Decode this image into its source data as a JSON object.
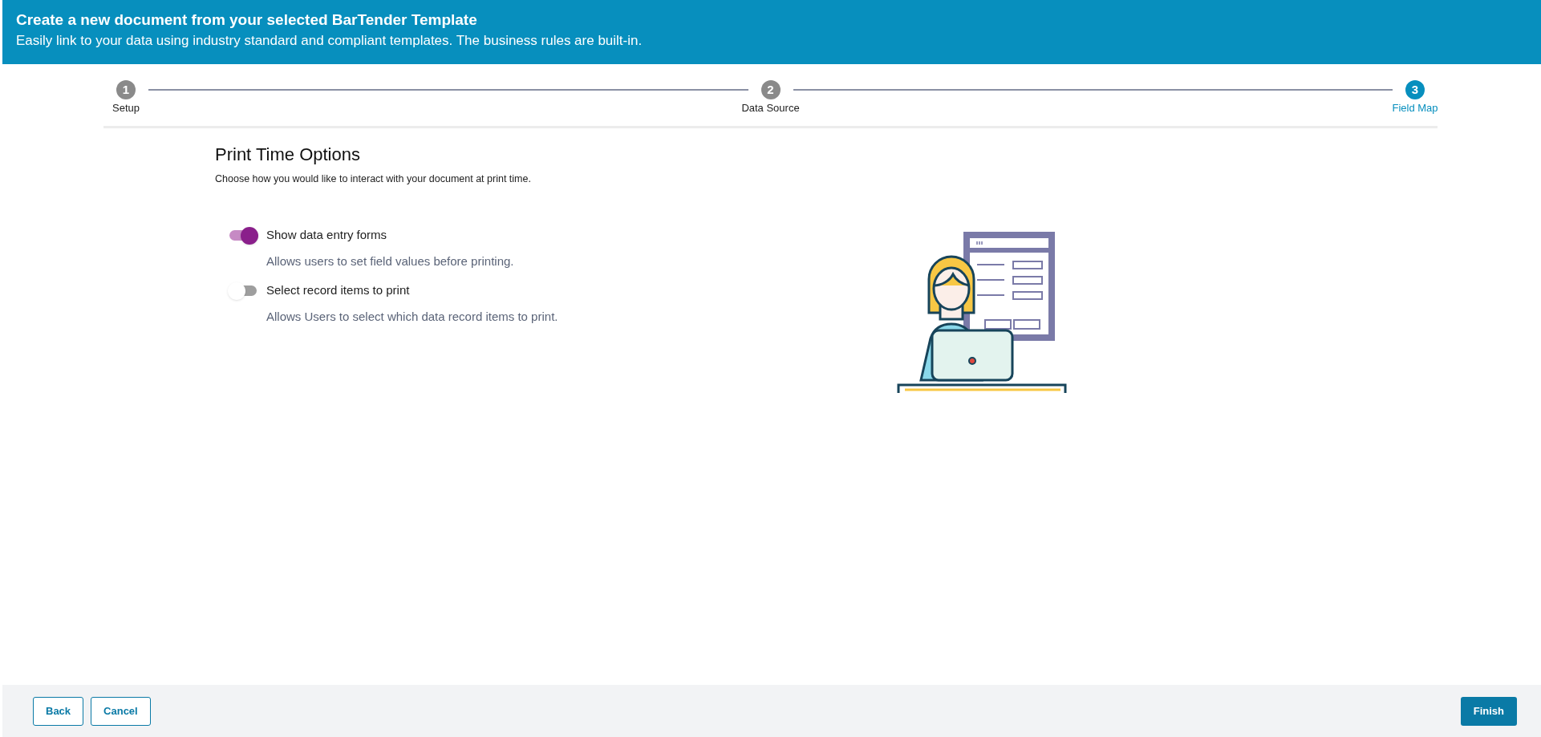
{
  "header": {
    "title": "Create a new document from your selected BarTender Template",
    "subtitle": "Easily link to your data using industry standard and compliant templates. The business rules are built-in."
  },
  "steps": [
    {
      "number": "1",
      "label": "Setup",
      "selected": false
    },
    {
      "number": "2",
      "label": "Data Source",
      "selected": false
    },
    {
      "number": "3",
      "label": "Field Map",
      "selected": true
    }
  ],
  "section": {
    "title": "Print Time Options",
    "description": "Choose how you would like to interact with your document at print time."
  },
  "options": [
    {
      "label": "Show data entry forms",
      "hint": "Allows users to set field values before printing.",
      "on": true
    },
    {
      "label": "Select record items to print",
      "hint": "Allows Users to select which data record items to print.",
      "on": false
    }
  ],
  "footer": {
    "left_buttons": [
      "Back",
      "Cancel"
    ],
    "primary_button": "Finish"
  }
}
